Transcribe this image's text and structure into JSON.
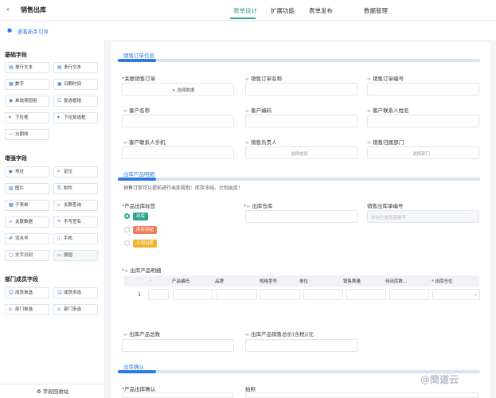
{
  "header": {
    "back_icon": "chevron-left-icon",
    "title": "销售出库",
    "tabs": [
      "表单设计",
      "扩展功能",
      "表单发布",
      "数据管理"
    ]
  },
  "guide": {
    "text": "查看新手引导"
  },
  "sidebar": {
    "basic": {
      "title": "基础字段",
      "items": [
        "单行文本",
        "多行文本",
        "数字",
        "日期时间",
        "单选按钮组",
        "复选框组",
        "下拉框",
        "下拉复选框",
        "分割线"
      ]
    },
    "enhanced": {
      "title": "增强字段",
      "items": [
        "地址",
        "定位",
        "图片",
        "附件",
        "子表单",
        "关联查询",
        "关联数据",
        "手写签名",
        "流水号",
        "手机",
        "文字识别",
        "按钮"
      ]
    },
    "member": {
      "title": "部门成员字段",
      "items": [
        "成员单选",
        "成员多选",
        "部门单选",
        "部门多选"
      ]
    },
    "recycle": "字段回收站"
  },
  "form": {
    "section1": {
      "title": "销售订单信息",
      "fields": [
        {
          "label": "关联销售订单",
          "required": true,
          "value": "选择数据"
        },
        {
          "label": "销售订单名称"
        },
        {
          "label": "销售订单编号"
        },
        {
          "label": "客户名称"
        },
        {
          "label": "客户编码"
        },
        {
          "label": "客户联系人姓名"
        },
        {
          "label": "客户联系人手机"
        },
        {
          "label": "销售负责人",
          "placeholder": "选择成员"
        },
        {
          "label": "销售归属部门",
          "placeholder": "选择部门"
        }
      ]
    },
    "section2": {
      "title": "出库产品明细",
      "hint": "销售订单可以提前进行出库规划：库存冻结、计划出库！",
      "tag_label": "产品出库标签",
      "tags": [
        {
          "text": "出库",
          "color": "#2fa58f",
          "checked": true
        },
        {
          "text": "库存冻结",
          "color": "#f07b5a",
          "checked": false
        },
        {
          "text": "计划出库",
          "color": "#f0b429",
          "checked": false
        }
      ],
      "warehouse_label": "出库仓库",
      "number_label": "销售出库单编号",
      "number_placeholder": "自动生成无需填写",
      "detail_label": "出库产品明细",
      "table_headers": [
        ":",
        "产品编码",
        "品牌",
        "规格型号",
        "单位",
        "销售数量",
        "待出库数...",
        "* 出库仓位"
      ],
      "row_index": "1",
      "total_label": "出库产品总数",
      "amount_label": "出库产品销售总价(含税)/元"
    },
    "section3": {
      "title": "出库确认",
      "confirm_label": "产品出库确认",
      "photo_label": "拍照"
    }
  },
  "watermark": "@简道云",
  "colors": {
    "accent": "#2fa58f",
    "link": "#2c7be5",
    "required": "#e5484d"
  }
}
